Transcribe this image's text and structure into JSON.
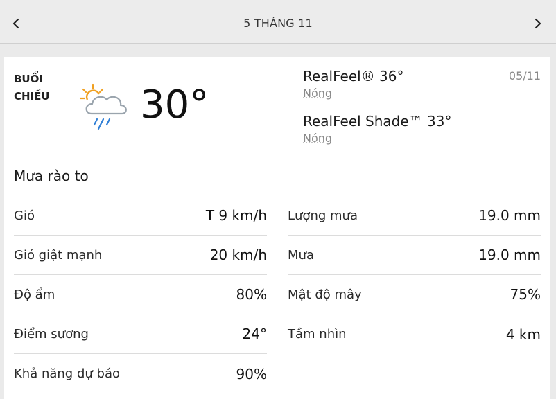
{
  "header": {
    "date_title": "5 THÁNG 11",
    "prev_icon": "chevron-left-icon",
    "next_icon": "chevron-right-icon"
  },
  "summary": {
    "period": "BUỔI CHIỀU",
    "icon": "partly-sunny-rain-icon",
    "temperature": "30°",
    "date_short": "05/11",
    "realfeel": {
      "label": "RealFeel® 36°",
      "desc": "Nóng"
    },
    "realfeel_shade": {
      "label": "RealFeel Shade™ 33°",
      "desc": "Nóng"
    },
    "condition": "Mưa rào to"
  },
  "details_left": [
    {
      "label": "Gió",
      "value": "T 9 km/h"
    },
    {
      "label": "Gió giật mạnh",
      "value": "20 km/h"
    },
    {
      "label": "Độ ẩm",
      "value": "80%"
    },
    {
      "label": "Điểm sương",
      "value": "24°"
    },
    {
      "label": "Khả năng dự báo",
      "value": "90%"
    }
  ],
  "details_right": [
    {
      "label": "Lượng mưa",
      "value": "19.0 mm"
    },
    {
      "label": "Mưa",
      "value": "19.0 mm"
    },
    {
      "label": "Mật độ mây",
      "value": "75%"
    },
    {
      "label": "Tầm nhìn",
      "value": "4 km"
    }
  ],
  "colors": {
    "sun": "#f0a020",
    "cloud": "#9aa4ad",
    "rain": "#2f7fd6",
    "muted_text": "#8a8a8a"
  }
}
